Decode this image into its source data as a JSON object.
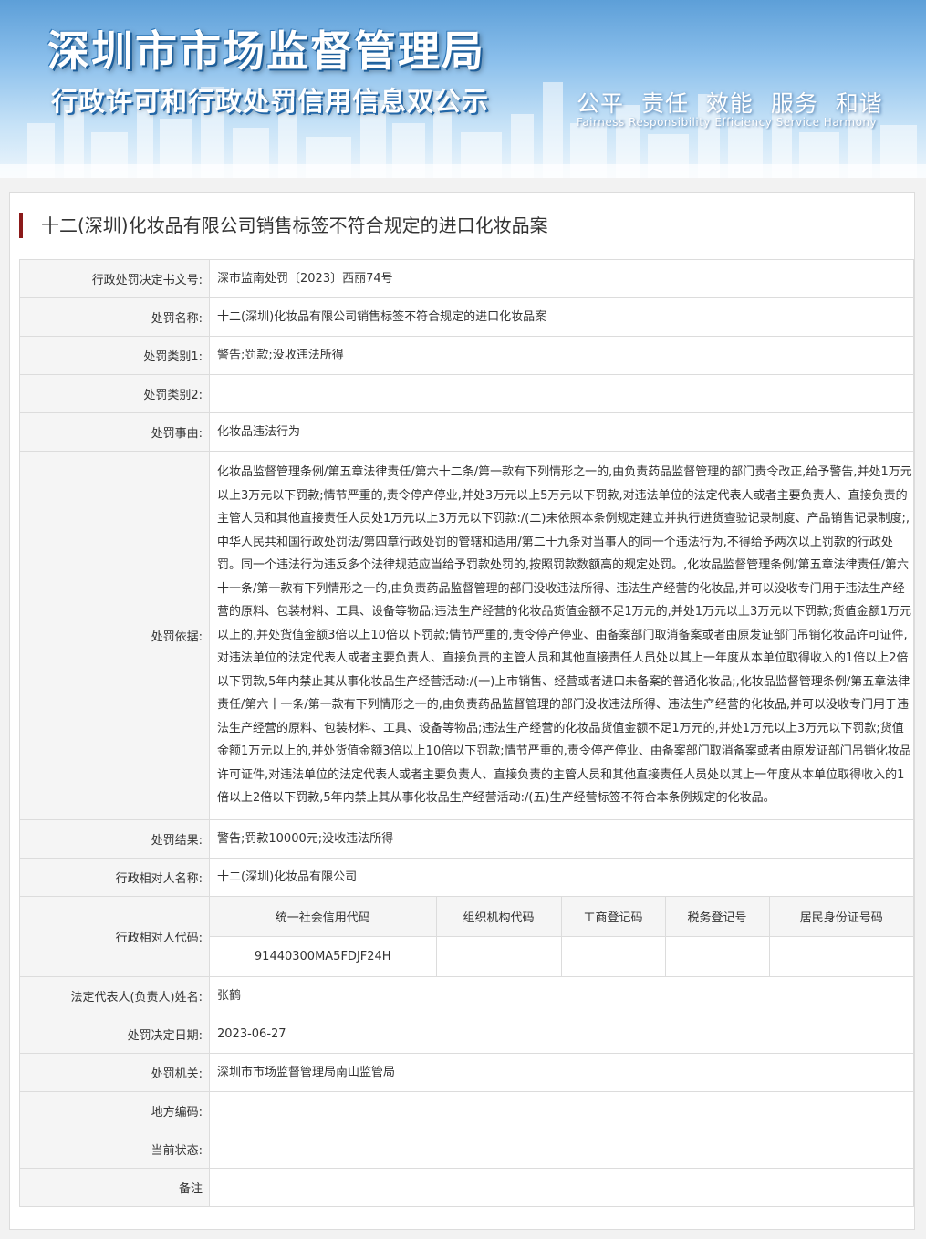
{
  "banner": {
    "title_main": "深圳市市场监督管理局",
    "title_sub": "行政许可和行政处罚信用信息双公示",
    "slogan_cn": "公平 责任 效能 服务 和谐",
    "slogan_en": "Fairness Responsibility Efficiency Service Harmony"
  },
  "case_title": "十二(深圳)化妆品有限公司销售标签不符合规定的进口化妆品案",
  "rows": [
    {
      "label": "行政处罚决定书文号:",
      "value": "深市监南处罚〔2023〕西丽74号"
    },
    {
      "label": "处罚名称:",
      "value": "十二(深圳)化妆品有限公司销售标签不符合规定的进口化妆品案"
    },
    {
      "label": "处罚类别1:",
      "value": "警告;罚款;没收违法所得"
    },
    {
      "label": "处罚类别2:",
      "value": ""
    },
    {
      "label": "处罚事由:",
      "value": "化妆品违法行为"
    },
    {
      "label": "处罚依据:",
      "value": "化妆品监督管理条例/第五章法律责任/第六十二条/第一款有下列情形之一的,由负责药品监督管理的部门责令改正,给予警告,并处1万元以上3万元以下罚款;情节严重的,责令停产停业,并处3万元以上5万元以下罚款,对违法单位的法定代表人或者主要负责人、直接负责的主管人员和其他直接责任人员处1万元以上3万元以下罚款:/(二)未依照本条例规定建立并执行进货查验记录制度、产品销售记录制度;,中华人民共和国行政处罚法/第四章行政处罚的管辖和适用/第二十九条对当事人的同一个违法行为,不得给予两次以上罚款的行政处罚。同一个违法行为违反多个法律规范应当给予罚款处罚的,按照罚款数额高的规定处罚。,化妆品监督管理条例/第五章法律责任/第六十一条/第一款有下列情形之一的,由负责药品监督管理的部门没收违法所得、违法生产经营的化妆品,并可以没收专门用于违法生产经营的原料、包装材料、工具、设备等物品;违法生产经营的化妆品货值金额不足1万元的,并处1万元以上3万元以下罚款;货值金额1万元以上的,并处货值金额3倍以上10倍以下罚款;情节严重的,责令停产停业、由备案部门取消备案或者由原发证部门吊销化妆品许可证件,对违法单位的法定代表人或者主要负责人、直接负责的主管人员和其他直接责任人员处以其上一年度从本单位取得收入的1倍以上2倍以下罚款,5年内禁止其从事化妆品生产经营活动:/(一)上市销售、经营或者进口未备案的普通化妆品;,化妆品监督管理条例/第五章法律责任/第六十一条/第一款有下列情形之一的,由负责药品监督管理的部门没收违法所得、违法生产经营的化妆品,并可以没收专门用于违法生产经营的原料、包装材料、工具、设备等物品;违法生产经营的化妆品货值金额不足1万元的,并处1万元以上3万元以下罚款;货值金额1万元以上的,并处货值金额3倍以上10倍以下罚款;情节严重的,责令停产停业、由备案部门取消备案或者由原发证部门吊销化妆品许可证件,对违法单位的法定代表人或者主要负责人、直接负责的主管人员和其他直接责任人员处以其上一年度从本单位取得收入的1倍以上2倍以下罚款,5年内禁止其从事化妆品生产经营活动:/(五)生产经营标签不符合本条例规定的化妆品。"
    },
    {
      "label": "处罚结果:",
      "value": "警告;罚款10000元;没收违法所得"
    },
    {
      "label": "行政相对人名称:",
      "value": "十二(深圳)化妆品有限公司"
    }
  ],
  "code_row": {
    "label": "行政相对人代码:",
    "headers": [
      "统一社会信用代码",
      "组织机构代码",
      "工商登记码",
      "税务登记号",
      "居民身份证号码"
    ],
    "values": [
      "91440300MA5FDJF24H",
      "",
      "",
      "",
      ""
    ]
  },
  "rows_after": [
    {
      "label": "法定代表人(负责人)姓名:",
      "value": "张鹤"
    },
    {
      "label": "处罚决定日期:",
      "value": "2023-06-27"
    },
    {
      "label": "处罚机关:",
      "value": "深圳市市场监督管理局南山监管局"
    },
    {
      "label": "地方编码:",
      "value": ""
    },
    {
      "label": "当前状态:",
      "value": ""
    },
    {
      "label": "备注",
      "value": ""
    }
  ]
}
